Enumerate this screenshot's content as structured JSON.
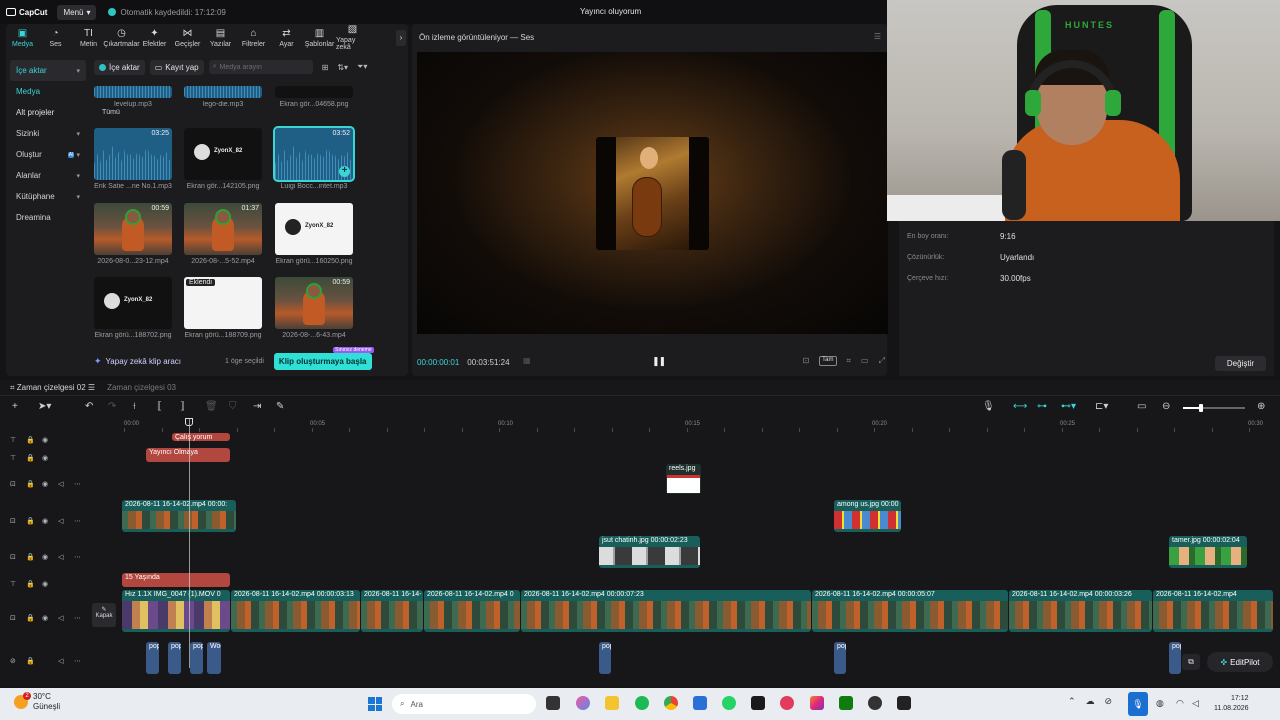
{
  "titlebar": {
    "app_name": "CapCut",
    "menu_label": "Menü",
    "autosave_text": "Otomatik kaydedildi: 17:12:09",
    "window_title": "Yayıncı oluyorum"
  },
  "toolbar": {
    "items": [
      {
        "label": "Medya",
        "icon": "media-icon",
        "glyph": "▣"
      },
      {
        "label": "Ses",
        "icon": "audio-icon",
        "glyph": "◔"
      },
      {
        "label": "Metin",
        "icon": "text-icon",
        "glyph": "TI"
      },
      {
        "label": "Çıkartmalar",
        "icon": "sticker-icon",
        "glyph": "◷"
      },
      {
        "label": "Efektler",
        "icon": "effects-icon",
        "glyph": "✦"
      },
      {
        "label": "Geçişler",
        "icon": "transitions-icon",
        "glyph": "⋈"
      },
      {
        "label": "Yazılar",
        "icon": "captions-icon",
        "glyph": "▤"
      },
      {
        "label": "Filtreler",
        "icon": "filters-icon",
        "glyph": "⌂"
      },
      {
        "label": "Ayar",
        "icon": "adjust-icon",
        "glyph": "⇄"
      },
      {
        "label": "Şablonlar",
        "icon": "templates-icon",
        "glyph": "▥"
      },
      {
        "label": "Yapay zekâ",
        "icon": "ai-icon",
        "glyph": "▧"
      }
    ],
    "more_glyph": "›"
  },
  "sidebar": {
    "items": [
      {
        "label": "İçe aktar",
        "chev": "▾"
      },
      {
        "label": "Medya",
        "chev": ""
      },
      {
        "label": "Alt projeler",
        "chev": ""
      },
      {
        "label": "Sizinki",
        "chev": "▾"
      },
      {
        "label": "Oluştur",
        "chev": "▾",
        "badge": "AI"
      },
      {
        "label": "Alanlar",
        "chev": "▾"
      },
      {
        "label": "Kütüphane",
        "chev": "▾"
      },
      {
        "label": "Dreamina",
        "chev": ""
      }
    ]
  },
  "media_bar": {
    "import_label": "İçe aktar",
    "record_label": "Kayıt yap",
    "search_placeholder": "Medya arayın",
    "all_label": "Tümü"
  },
  "media_items": [
    {
      "label": "levelup.mp3",
      "kind": "audio",
      "duration": ""
    },
    {
      "label": "lego-die.mp3",
      "kind": "audio",
      "duration": ""
    },
    {
      "label": "Ekran gör...04658.png",
      "kind": "shot-dark",
      "duration": ""
    },
    {
      "label": "Erik Satie ...ne No.1.mp3",
      "kind": "audio",
      "duration": "03:25"
    },
    {
      "label": "Ekran gör...142105.png",
      "kind": "shot-dark",
      "duration": "",
      "text": "ZyonX_82"
    },
    {
      "label": "Luigi Bocc...intet.mp3",
      "kind": "audio",
      "duration": "03:52",
      "selected": true
    },
    {
      "label": "2026-08-0...23-12.mp4",
      "kind": "video",
      "duration": "00:59"
    },
    {
      "label": "2026-08-...5-52.mp4",
      "kind": "video",
      "duration": "01:37"
    },
    {
      "label": "Ekran görü...160250.png",
      "kind": "shot-white",
      "duration": "",
      "text": "ZyonX_82"
    },
    {
      "label": "Ekran görü...188702.png",
      "kind": "shot-dark",
      "duration": "",
      "text": "ZyonX_82"
    },
    {
      "label": "Ekran görü...188709.png",
      "kind": "shot-white",
      "duration": "",
      "tag": "Eklendi"
    },
    {
      "label": "2026-08-...6-43.mp4",
      "kind": "video",
      "duration": "00:59"
    }
  ],
  "media_footer": {
    "ai_tool_label": "Yapay zekâ klip aracı",
    "selected_count": "1 öge seçildi",
    "clip_button": "Klip oluşturmaya başla",
    "clip_badge": "Sınırsız deneme"
  },
  "preview": {
    "title": "Ön izleme görüntüleniyor — Ses",
    "current_time": "00:00:00:01",
    "total_time": "00:03:51:24",
    "full_label": "Tam"
  },
  "properties": {
    "rows": [
      {
        "label": "En boy oranı:",
        "value": "9:16"
      },
      {
        "label": "Çözünürlük:",
        "value": "Uyarlandı"
      },
      {
        "label": "Çerçeve hızı:",
        "value": "30.00fps"
      }
    ],
    "change_button": "Değiştir"
  },
  "webcam": {
    "chair_brand": "HUNTES"
  },
  "timeline": {
    "tabs": [
      "Zaman çizelgesi 02",
      "Zaman çizelgesi 03"
    ],
    "ruler": [
      "00:00",
      "00:05",
      "00:10",
      "00:15",
      "00:20",
      "00:25",
      "00:30"
    ],
    "text_clips": [
      {
        "label": "Çalış yorum"
      },
      {
        "label": "Yayıncı Olmaya"
      },
      {
        "label": "15  Yaşında"
      }
    ],
    "overlay_clips": [
      {
        "label": "reels.jpg"
      },
      {
        "label": "2026-08-11 16-14-02.mp4  00:00:"
      },
      {
        "label": "among us.jpg  00:00"
      },
      {
        "label": "jsut chatinh.jpg  00:00:02:23"
      },
      {
        "label": "tamer.jpg  00:00:02:04"
      }
    ],
    "main_clips": [
      {
        "label": "Hız 1.1X  IMG_0047 (1).MOV  0"
      },
      {
        "label": "2026-08-11 16-14-02.mp4  00:00:03:13"
      },
      {
        "label": "2026-08-11 16-14-"
      },
      {
        "label": "2026-08-11 16-14-02.mp4  0"
      },
      {
        "label": "2026-08-11 16-14-02.mp4  00:00:07:23"
      },
      {
        "label": "2026-08-11 16-14-02.mp4  00:00:05:07"
      },
      {
        "label": "2026-08-11 16-14-02.mp4  00:00:03:26"
      },
      {
        "label": "2026-08-11 16-14-02.mp4"
      }
    ],
    "audio_clips": [
      "pop",
      "pop",
      "pop",
      "Woo",
      "pop",
      "pop",
      "pop"
    ],
    "cover_label": "Kapak",
    "editpilot_label": "EditPilot"
  },
  "taskbar": {
    "temperature": "30°C",
    "weather": "Güneşli",
    "weather_badge": "2",
    "search_label": "Ara",
    "time": "17:12",
    "date": "11.08.2026"
  }
}
